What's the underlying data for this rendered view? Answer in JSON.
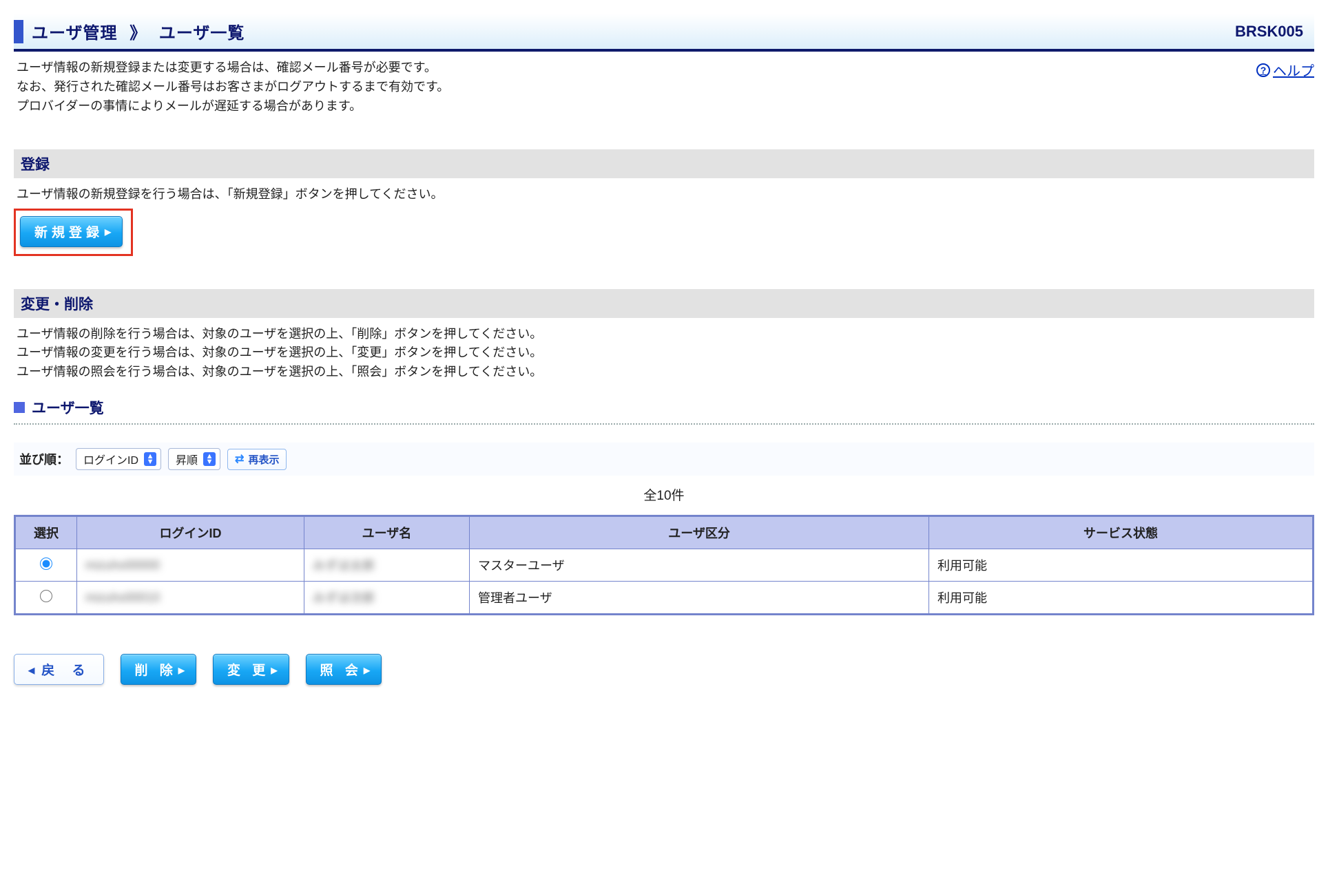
{
  "title": {
    "main": "ユーザ管理",
    "sep": "》",
    "sub": "ユーザ一覧",
    "code": "BRSK005"
  },
  "intro": {
    "line1": "ユーザ情報の新規登録または変更する場合は、確認メール番号が必要です。",
    "line2": "なお、発行された確認メール番号はお客さまがログアウトするまで有効です。",
    "line3": "プロバイダーの事情によりメールが遅延する場合があります。"
  },
  "help": {
    "label": "ヘルプ"
  },
  "register": {
    "heading": "登録",
    "desc": "ユーザ情報の新規登録を行う場合は、「新規登録」ボタンを押してください。",
    "button": "新規登録"
  },
  "modify": {
    "heading": "変更・削除",
    "line1": "ユーザ情報の削除を行う場合は、対象のユーザを選択の上、「削除」ボタンを押してください。",
    "line2": "ユーザ情報の変更を行う場合は、対象のユーザを選択の上、「変更」ボタンを押してください。",
    "line3": "ユーザ情報の照会を行う場合は、対象のユーザを選択の上、「照会」ボタンを押してください。"
  },
  "subhead": "ユーザ一覧",
  "sort": {
    "label": "並び順：",
    "field": "ログインID",
    "order": "昇順",
    "refresh": "再表示"
  },
  "totalcount": "全10件",
  "table": {
    "headers": {
      "select": "選択",
      "loginid": "ログインID",
      "username": "ユーザ名",
      "usertype": "ユーザ区分",
      "status": "サービス状態"
    },
    "rows": [
      {
        "selected": true,
        "loginid": "mizuho00000",
        "username": "みずほ太郎",
        "usertype": "マスターユーザ",
        "status": "利用可能"
      },
      {
        "selected": false,
        "loginid": "mizuho00010",
        "username": "みずほ次郎",
        "usertype": "管理者ユーザ",
        "status": "利用可能"
      }
    ]
  },
  "footer": {
    "back": "戻 る",
    "delete": "削 除",
    "change": "変 更",
    "inquire": "照 会"
  }
}
